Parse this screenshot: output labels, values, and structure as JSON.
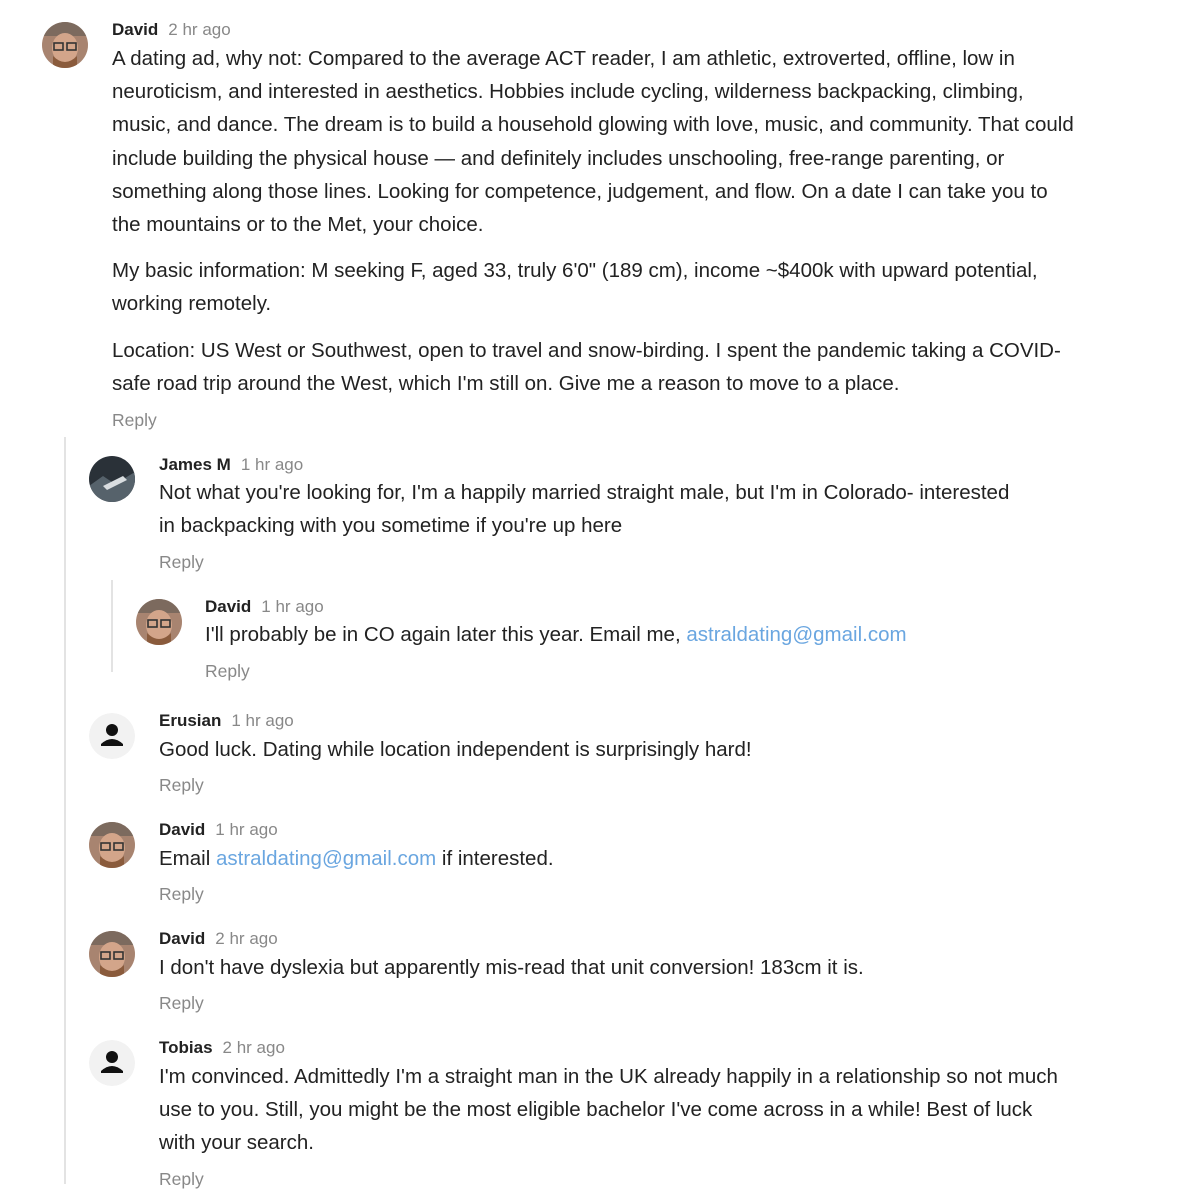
{
  "comments": [
    {
      "author": "David",
      "time": "2 hr ago",
      "paragraphs": [
        "A dating ad, why not: Compared to the average ACT reader, I am athletic, extroverted, offline, low in neuroticism, and interested in aesthetics. Hobbies include cycling, wilderness backpacking, climbing, music, and dance. The dream is to build a household glowing with love, music, and community. That could include building the physical house — and definitely includes unschooling, free-range parenting, or something along those lines. Looking for competence, judgement, and flow. On a date I can take you to the mountains or to the Met, your choice.",
        "My basic information: M seeking F, aged 33, truly 6'0\" (189 cm), income ~$400k with upward potential, working remotely.",
        "Location: US West or Southwest, open to travel and snow-birding. I spent the pandemic taking a COVID-safe road trip around the West, which I'm still on. Give me a reason to move to a place."
      ],
      "reply": "Reply"
    },
    {
      "author": "James M",
      "time": "1 hr ago",
      "text": "Not what you're looking for, I'm a happily married straight male, but I'm in Colorado- interested in backpacking with you sometime if you're up here",
      "reply": "Reply"
    },
    {
      "author": "David",
      "time": "1 hr ago",
      "text_before": "I'll probably be in CO again later this year. Email me, ",
      "link": "astraldating@gmail.com",
      "reply": "Reply"
    },
    {
      "author": "Erusian",
      "time": "1 hr ago",
      "text": "Good luck. Dating while location independent is surprisingly hard!",
      "reply": "Reply"
    },
    {
      "author": "David",
      "time": "1 hr ago",
      "text_before": "Email ",
      "link": "astraldating@gmail.com",
      "text_after": " if interested.",
      "reply": "Reply"
    },
    {
      "author": "David",
      "time": "2 hr ago",
      "text": "I don't have dyslexia but apparently mis-read that unit conversion! 183cm it is.",
      "reply": "Reply"
    },
    {
      "author": "Tobias",
      "time": "2 hr ago",
      "text": "I'm convinced. Admittedly I'm a straight man in the UK already happily in a relationship so not much use to you. Still, you might be the most eligible bachelor I've come across in a while! Best of luck with your search.",
      "reply": "Reply"
    }
  ],
  "colors": {
    "link": "#6aa6e0",
    "meta": "#888888",
    "thread_line": "#e3e3e3"
  },
  "icons": {
    "david": "user-photo-icon",
    "james": "landscape-photo-icon",
    "default": "default-user-silhouette-icon"
  }
}
